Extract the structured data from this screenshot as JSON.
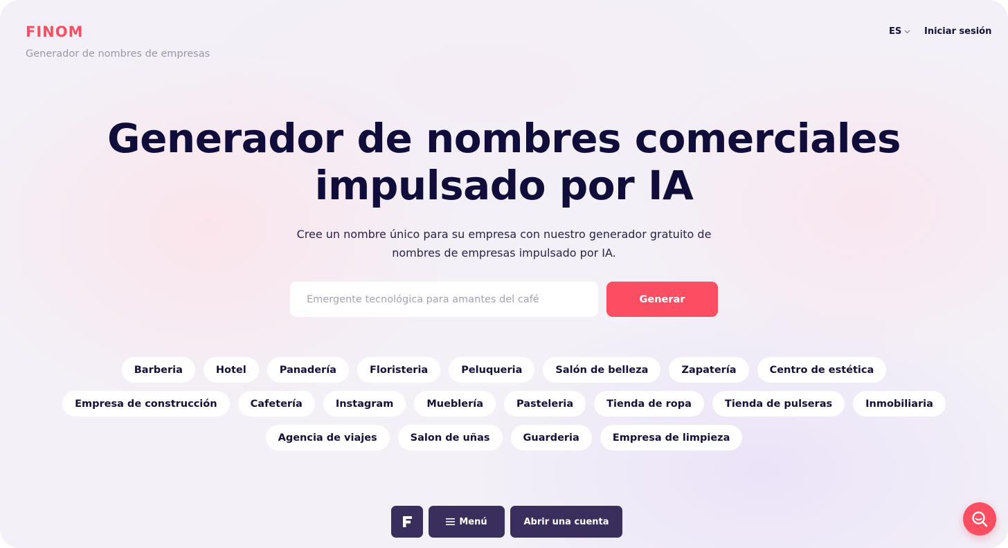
{
  "header": {
    "logo_text": "FINOM",
    "tagline": "Generador de nombres de empresas",
    "language": "ES",
    "login_label": "Iniciar sesión"
  },
  "hero": {
    "title": "Generador de nombres comerciales impulsado por IA",
    "subtitle": "Cree un nombre único para su empresa con nuestro generador gratuito de nombres de empresas impulsado por IA."
  },
  "search": {
    "placeholder": "Emergente tecnológica para amantes del café",
    "value": "",
    "button_label": "Generar"
  },
  "categories": {
    "rows": [
      [
        "Barberia",
        "Hotel",
        "Panadería",
        "Floristeria",
        "Peluqueria",
        "Salón de belleza",
        "Zapatería",
        "Centro de estética"
      ],
      [
        "Empresa de construcción",
        "Cafetería",
        "Instagram",
        "Mueblería",
        "Pasteleria",
        "Tienda de ropa",
        "Tienda de pulseras",
        "Inmobiliaria"
      ],
      [
        "Agencia de viajes",
        "Salon de uñas",
        "Guarderia",
        "Empresa de limpieza"
      ]
    ]
  },
  "bottom_bar": {
    "menu_label": "Menú",
    "account_label": "Abrir una cuenta"
  },
  "colors": {
    "accent": "#fb4e62",
    "dark_button": "#3a2f5c",
    "text": "#13103a",
    "muted": "#9a97aa"
  },
  "icons": {
    "lang_chevron": "chevron-down-icon",
    "menu": "hamburger-icon",
    "brand": "finom-f-icon",
    "fab": "search-chat-icon"
  }
}
